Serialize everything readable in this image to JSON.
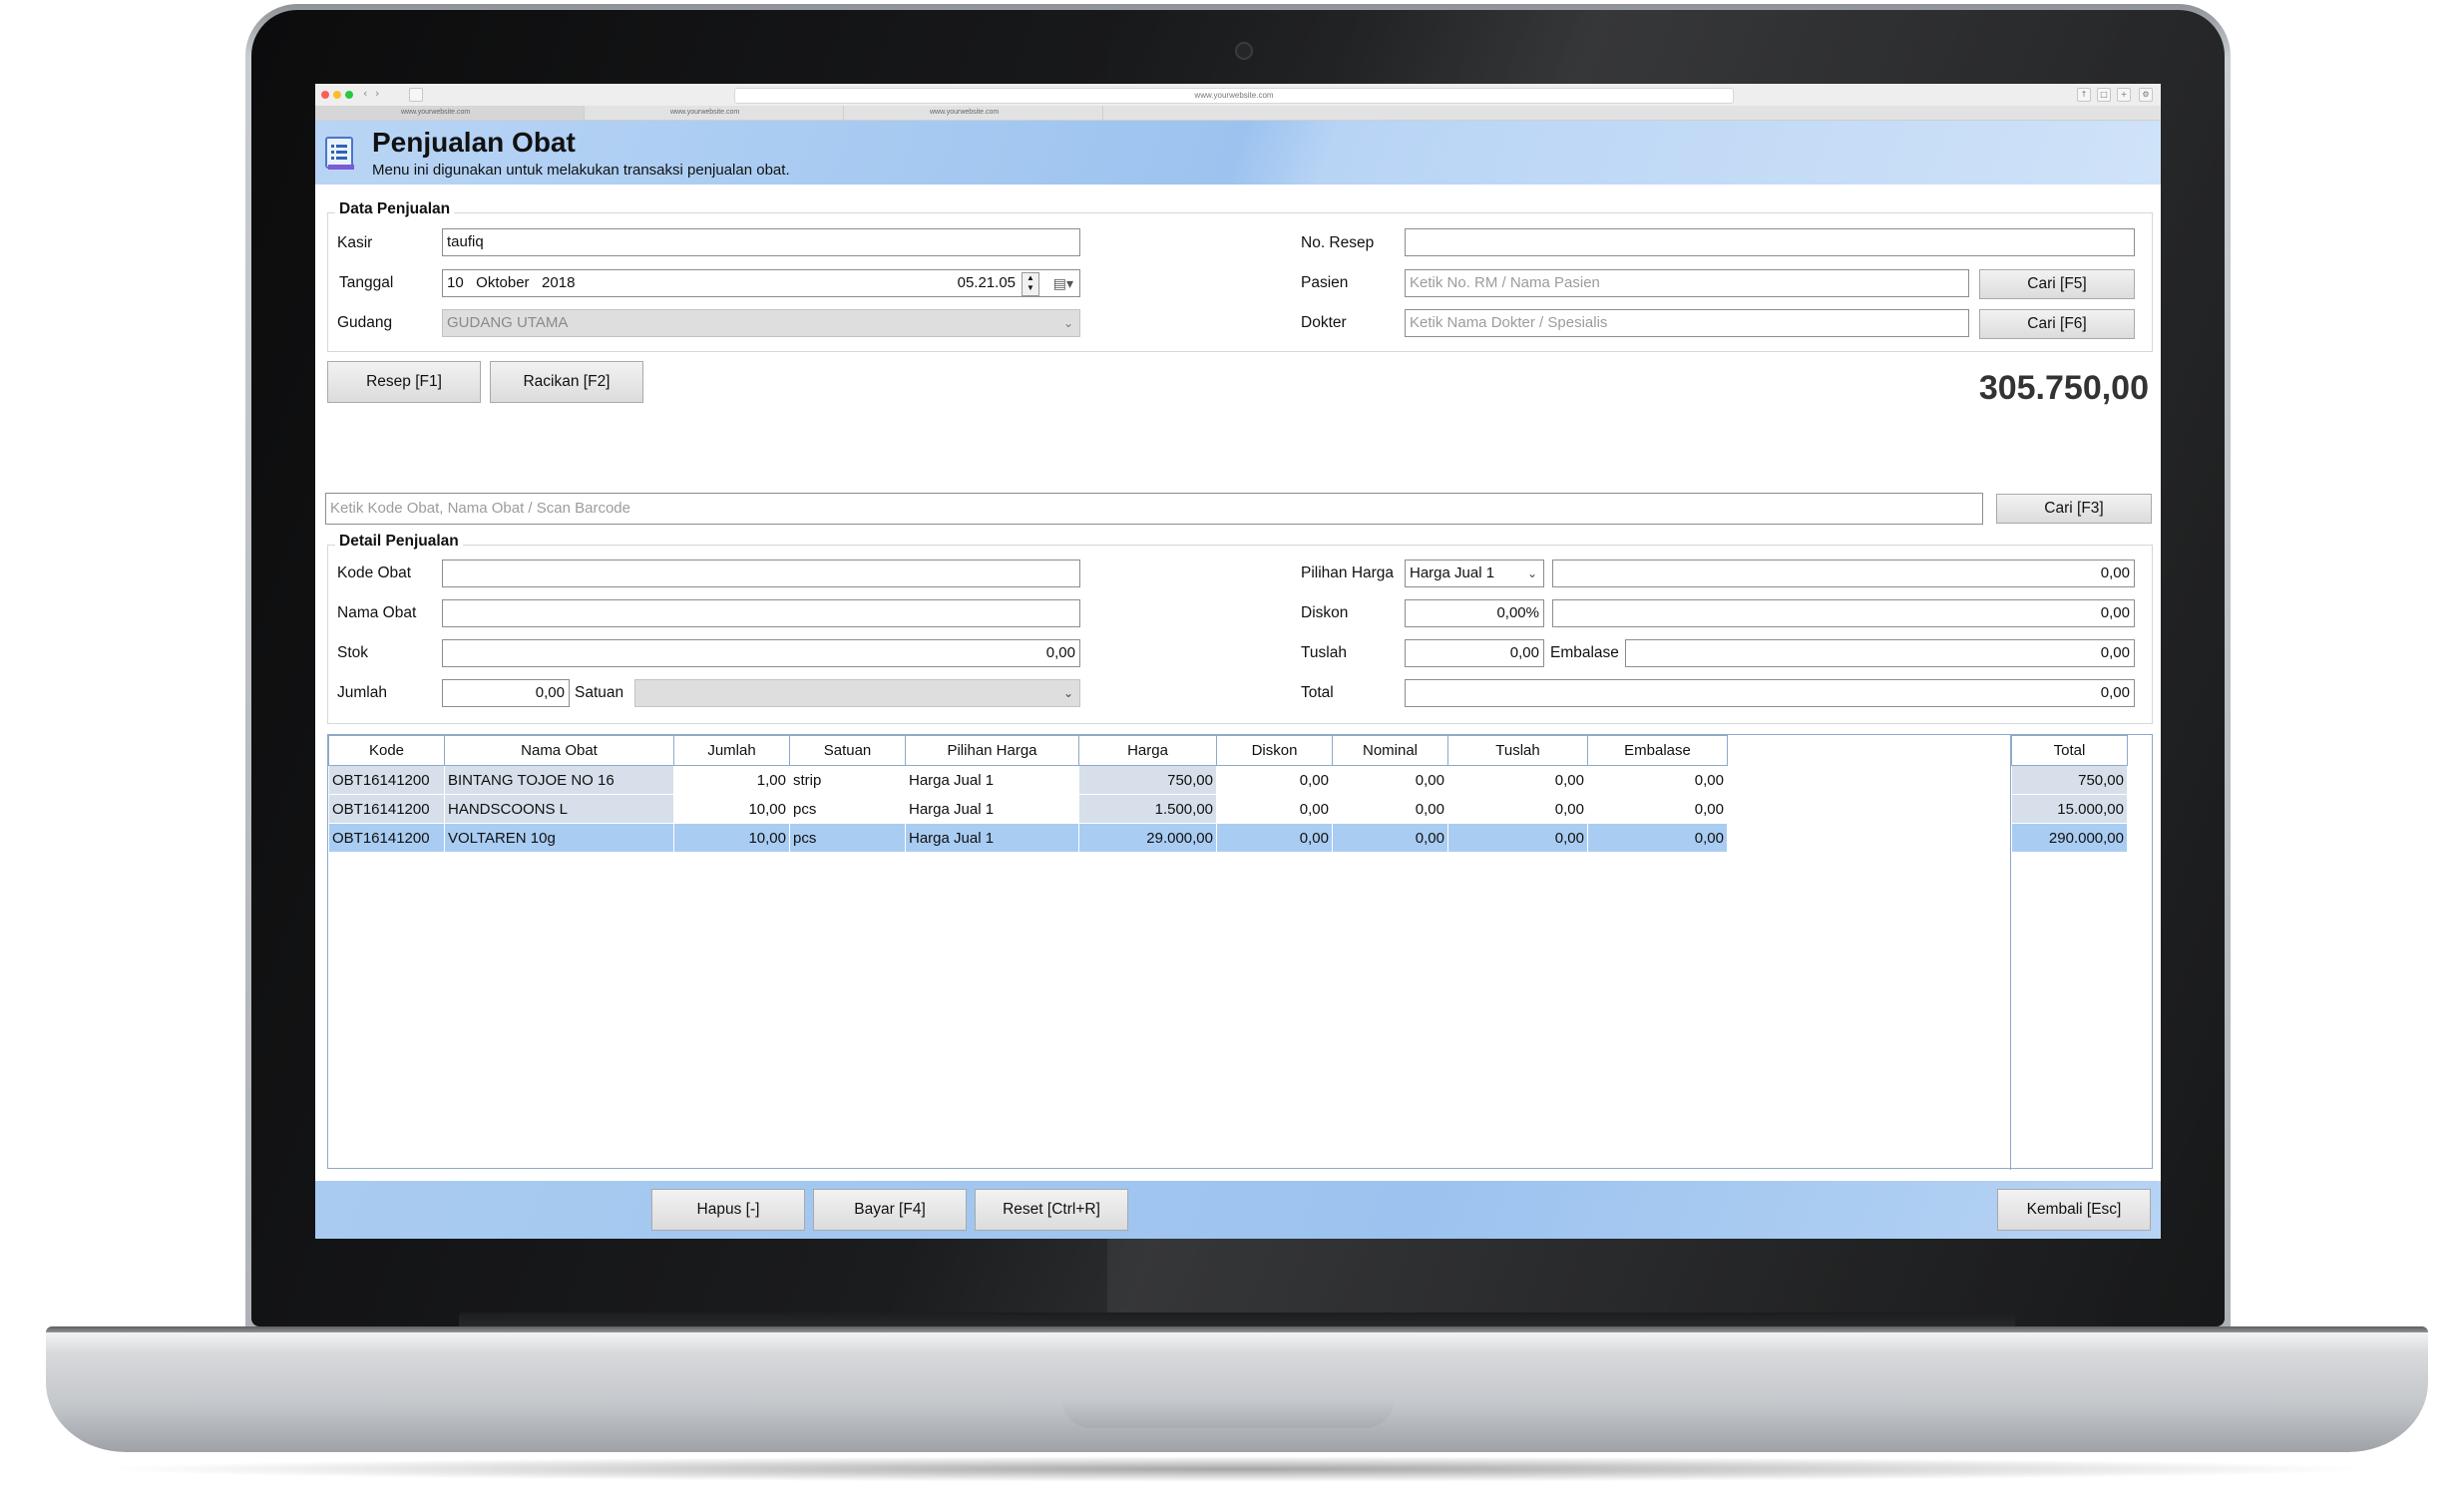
{
  "browser": {
    "url": "www.yourwebsite.com",
    "tabs": [
      "www.yourwebsite.com",
      "www.yourwebsite.com",
      "www.yourwebsite.com"
    ]
  },
  "header": {
    "title": "Penjualan Obat",
    "subtitle": "Menu ini digunakan untuk melakukan transaksi penjualan obat."
  },
  "data_penjualan": {
    "title": "Data Penjualan",
    "kasir_label": "Kasir",
    "kasir_value": "taufiq",
    "tanggal_label": "Tanggal",
    "tanggal_date": "10   Oktober   2018",
    "tanggal_time": "05.21.05",
    "gudang_label": "Gudang",
    "gudang_value": "GUDANG UTAMA",
    "no_resep_label": "No. Resep",
    "no_resep_value": "",
    "pasien_label": "Pasien",
    "pasien_placeholder": "Ketik No. RM / Nama Pasien",
    "pasien_button": "Cari [F5]",
    "dokter_label": "Dokter",
    "dokter_placeholder": "Ketik Nama Dokter / Spesialis",
    "dokter_button": "Cari [F6]"
  },
  "actions": {
    "resep": "Resep [F1]",
    "racikan": "Racikan [F2]"
  },
  "grand_total": "305.750,00",
  "search": {
    "placeholder": "Ketik Kode Obat, Nama Obat / Scan Barcode",
    "button": "Cari [F3]"
  },
  "detail": {
    "title": "Detail Penjualan",
    "kode_label": "Kode Obat",
    "nama_label": "Nama Obat",
    "stok_label": "Stok",
    "stok_value": "0,00",
    "jumlah_label": "Jumlah",
    "jumlah_value": "0,00",
    "satuan_label": "Satuan",
    "pilihan_label": "Pilihan Harga",
    "pilihan_value": "Harga Jual 1",
    "pilihan_amount": "0,00",
    "diskon_label": "Diskon",
    "diskon_pct": "0,00%",
    "diskon_amount": "0,00",
    "tuslah_label": "Tuslah",
    "tuslah_value": "0,00",
    "embalase_label": "Embalase",
    "embalase_value": "0,00",
    "total_label": "Total",
    "total_value": "0,00"
  },
  "table": {
    "headers": [
      "Kode",
      "Nama Obat",
      "Jumlah",
      "Satuan",
      "Pilihan Harga",
      "Harga",
      "Diskon",
      "Nominal",
      "Tuslah",
      "Embalase"
    ],
    "total_header": "Total",
    "rows": [
      {
        "kode": "OBT16141200",
        "nama": "BINTANG TOJOE NO 16",
        "jumlah": "1,00",
        "satuan": "strip",
        "pilihan": "Harga Jual 1",
        "harga": "750,00",
        "diskon": "0,00",
        "nominal": "0,00",
        "tuslah": "0,00",
        "embalase": "0,00",
        "total": "750,00"
      },
      {
        "kode": "OBT16141200",
        "nama": "HANDSCOONS L",
        "jumlah": "10,00",
        "satuan": "pcs",
        "pilihan": "Harga Jual 1",
        "harga": "1.500,00",
        "diskon": "0,00",
        "nominal": "0,00",
        "tuslah": "0,00",
        "embalase": "0,00",
        "total": "15.000,00"
      },
      {
        "kode": "OBT16141200",
        "nama": "VOLTAREN 10g",
        "jumlah": "10,00",
        "satuan": "pcs",
        "pilihan": "Harga Jual 1",
        "harga": "29.000,00",
        "diskon": "0,00",
        "nominal": "0,00",
        "tuslah": "0,00",
        "embalase": "0,00",
        "total": "290.000,00"
      }
    ]
  },
  "footer": {
    "hapus": "Hapus [-]",
    "bayar": "Bayar [F4]",
    "reset": "Reset [Ctrl+R]",
    "kembali": "Kembali [Esc]"
  },
  "colors": {
    "header_blue": "#9cc3ef",
    "selected_row": "#a9ccf2",
    "grid_border": "#8ea9c9"
  }
}
